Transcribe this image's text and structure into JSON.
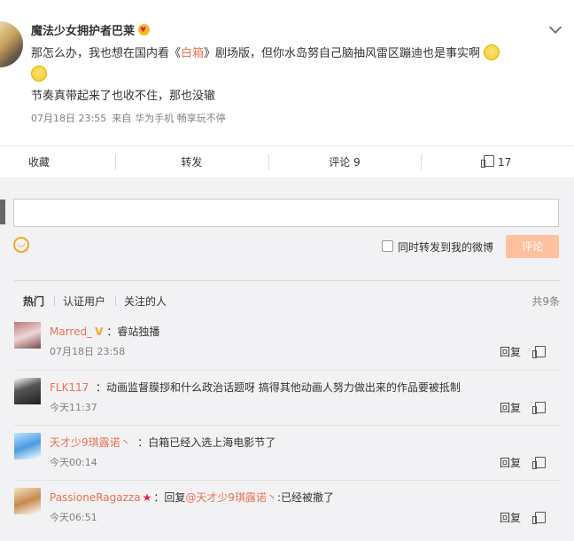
{
  "post": {
    "author": "魔法少女拥护者巴莱",
    "text_line1_a": "那怎么办，我也想在国内看《",
    "text_highlight": "白箱",
    "text_line1_b": "》剧场版，但你水岛努自己脑抽风雷区蹦迪也是事实啊",
    "text_line2": "节奏真带起来了也收不住，那也没辙",
    "date": "07月18日 23:55",
    "source_prefix": "来自",
    "source": "华为手机 畅享玩不停"
  },
  "actions": {
    "collect": "收藏",
    "forward": "转发",
    "comment": "评论 9",
    "like": "17"
  },
  "composer": {
    "forward_label": "同时转发到我的微博",
    "submit_label": "评论"
  },
  "tabs": {
    "hot": "热门",
    "verified": "认证用户",
    "following": "关注的人",
    "count": "共9条"
  },
  "comments": [
    {
      "user": "Marred_",
      "text": "：睿站独播",
      "time": "07月18日 23:58",
      "reply": "回复"
    },
    {
      "user": "FLK117",
      "text": "：动画监督膜拶和什么政治话题呀 搞得其他动画人努力做出来的作品要被抵制",
      "time": "今天11:37",
      "reply": "回复"
    },
    {
      "user": "天才少9琪露诺丶",
      "text": "：白箱已经入选上海电影节了",
      "time": "今天00:14",
      "reply": "回复"
    },
    {
      "user": "PassioneRagazza",
      "text_prefix": "：回复",
      "mention": "@天才少9琪露诺丶",
      "text_suffix": ":已经被撤了",
      "time": "今天06:51",
      "reply": "回复"
    }
  ],
  "colors": {
    "accent": "#eb7350",
    "submit_disabled": "#ffc09f",
    "vip": "#f5a623"
  }
}
